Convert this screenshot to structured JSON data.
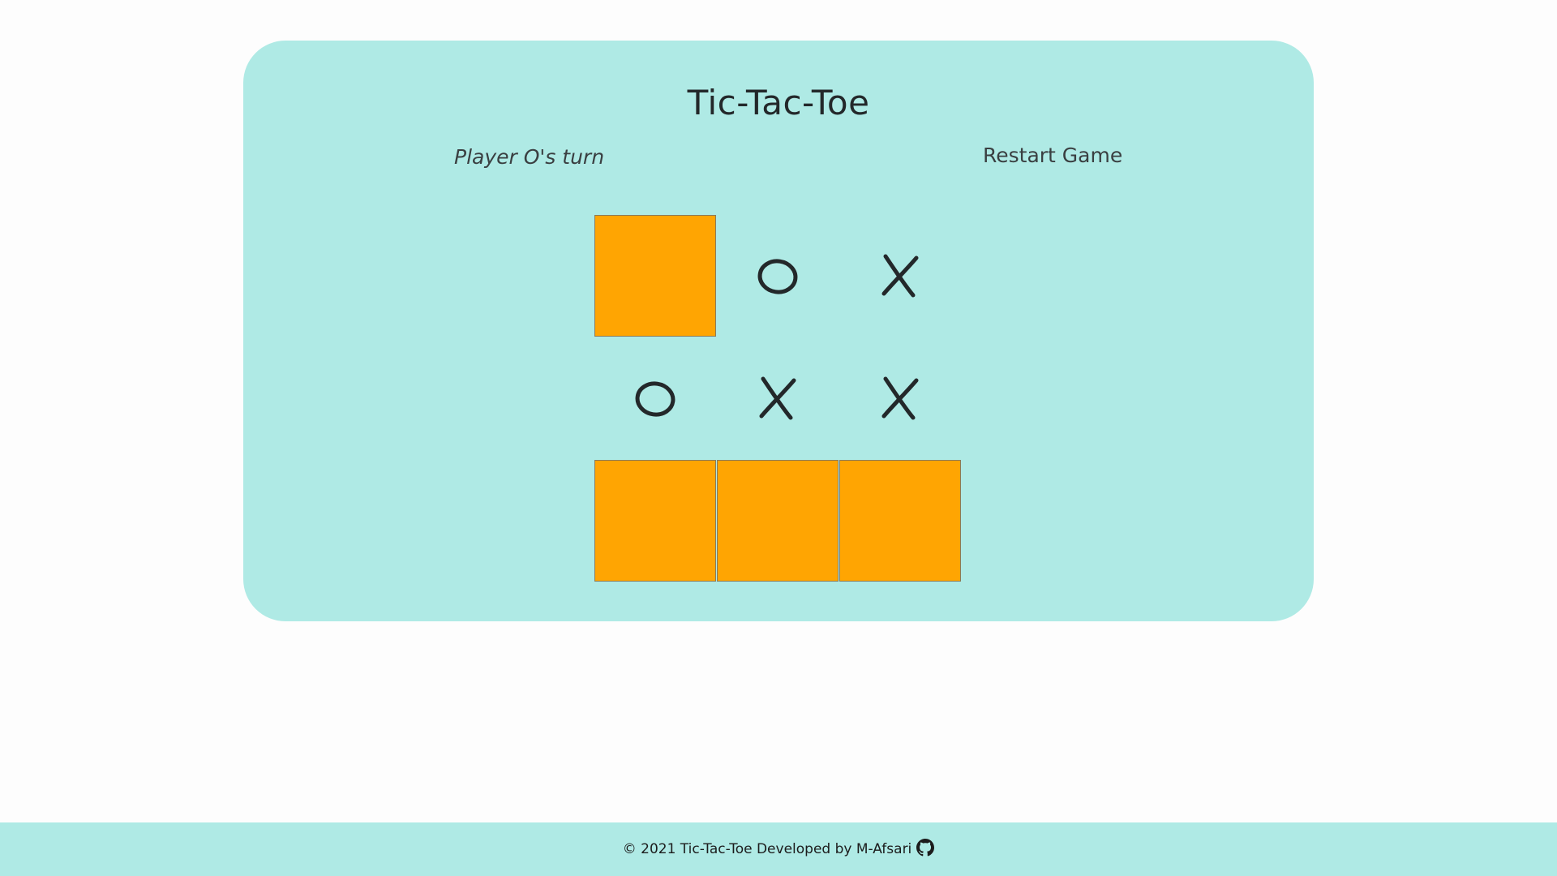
{
  "game": {
    "title": "Tic-Tac-Toe",
    "status": "Player O's turn",
    "restart_label": "Restart Game",
    "colors": {
      "panel": "#afeae5",
      "empty_cell": "#ffa502",
      "mark": "#23282a"
    },
    "board": [
      "",
      "O",
      "X",
      "O",
      "X",
      "X",
      "",
      "",
      ""
    ]
  },
  "footer": {
    "text": "© 2021 Tic-Tac-Toe Developed by M-Afsari",
    "icon": "github-icon"
  }
}
